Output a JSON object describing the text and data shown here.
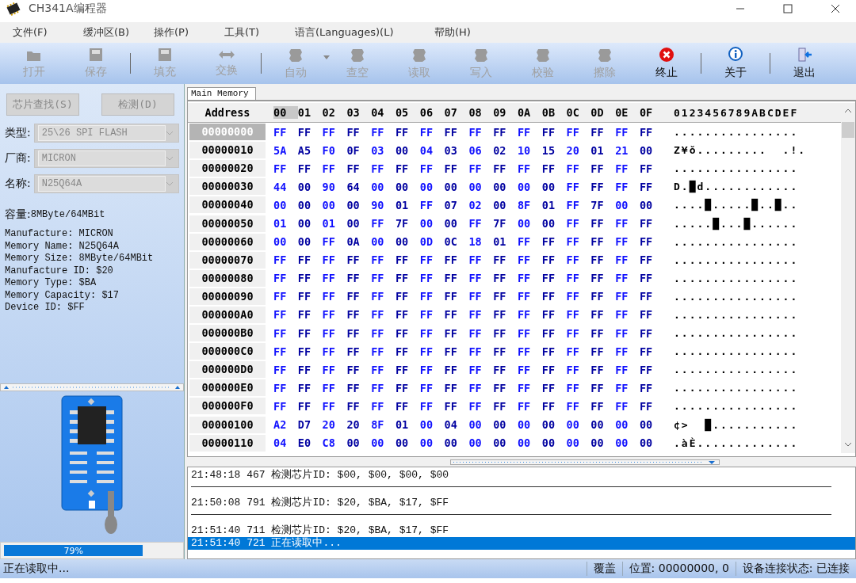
{
  "window": {
    "title": "CH341A编程器"
  },
  "menu": [
    "文件(F)",
    "缓冲区(B)",
    "操作(P)",
    "工具(T)",
    "语言(Languages)(L)",
    "帮助(H)"
  ],
  "toolbar": [
    {
      "label": "打开",
      "disabled": true,
      "separator_after": false,
      "dropdown": false
    },
    {
      "label": "保存",
      "disabled": true,
      "separator_after": true,
      "dropdown": false
    },
    {
      "label": "填充",
      "disabled": true,
      "separator_after": false,
      "dropdown": false
    },
    {
      "label": "交换",
      "disabled": true,
      "separator_after": true,
      "dropdown": false
    },
    {
      "label": "自动",
      "disabled": true,
      "separator_after": false,
      "dropdown": true
    },
    {
      "label": "查空",
      "disabled": true,
      "separator_after": false,
      "dropdown": false
    },
    {
      "label": "读取",
      "disabled": true,
      "separator_after": false,
      "dropdown": false
    },
    {
      "label": "写入",
      "disabled": true,
      "separator_after": false,
      "dropdown": false
    },
    {
      "label": "校验",
      "disabled": true,
      "separator_after": false,
      "dropdown": false
    },
    {
      "label": "擦除",
      "disabled": true,
      "separator_after": false,
      "dropdown": false
    },
    {
      "label": "终止",
      "disabled": false,
      "separator_after": true,
      "dropdown": false
    },
    {
      "label": "关于",
      "disabled": false,
      "separator_after": true,
      "dropdown": false
    },
    {
      "label": "退出",
      "disabled": false,
      "separator_after": false,
      "dropdown": false
    }
  ],
  "chip_panel": {
    "buttons": [
      "芯片查找(S)",
      "检测(D)"
    ],
    "fields": [
      {
        "label": "类型:",
        "value": "25\\26 SPI FLASH",
        "disabled": true
      },
      {
        "label": "厂商:",
        "value": "MICRON",
        "disabled": true
      },
      {
        "label": "名称:",
        "value": "N25Q64A",
        "disabled": true
      }
    ],
    "capacity": {
      "label": "容量:",
      "value": "8MByte/64MBit"
    },
    "info": [
      "Manufacture: MICRON",
      "Memory Name: N25Q64A",
      "Memory Size: 8MByte/64MBit",
      "Manufacture ID: $20",
      "Memory Type: $BA",
      "Memory Capacity: $17",
      "Device ID: $FF"
    ],
    "progress": {
      "level": 0.79,
      "label": "79%"
    }
  },
  "hex_view": {
    "tab": "Main Memory",
    "address_header": "Address",
    "columns": [
      "00",
      "01",
      "02",
      "03",
      "04",
      "05",
      "06",
      "07",
      "08",
      "09",
      "0A",
      "0B",
      "0C",
      "0D",
      "0E",
      "0F"
    ],
    "ascii_header": "0123456789ABCDEF",
    "rows": [
      {
        "address": "00000000",
        "selected": true,
        "bytes": [
          "FF",
          "FF",
          "FF",
          "FF",
          "FF",
          "FF",
          "FF",
          "FF",
          "FF",
          "FF",
          "FF",
          "FF",
          "FF",
          "FF",
          "FF",
          "FF"
        ],
        "ascii": "................"
      },
      {
        "address": "00000010",
        "selected": false,
        "bytes": [
          "5A",
          "A5",
          "F0",
          "0F",
          "03",
          "00",
          "04",
          "03",
          "06",
          "02",
          "10",
          "15",
          "20",
          "01",
          "21",
          "00"
        ],
        "ascii": "Z¥ŏ.........  .!."
      },
      {
        "address": "00000020",
        "selected": false,
        "bytes": [
          "FF",
          "FF",
          "FF",
          "FF",
          "FF",
          "FF",
          "FF",
          "FF",
          "FF",
          "FF",
          "FF",
          "FF",
          "FF",
          "FF",
          "FF",
          "FF"
        ],
        "ascii": "................"
      },
      {
        "address": "00000030",
        "selected": false,
        "bytes": [
          "44",
          "00",
          "90",
          "64",
          "00",
          "00",
          "00",
          "00",
          "00",
          "00",
          "00",
          "00",
          "FF",
          "FF",
          "FF",
          "FF"
        ],
        "ascii": "D.█d............"
      },
      {
        "address": "00000040",
        "selected": false,
        "bytes": [
          "00",
          "00",
          "00",
          "00",
          "90",
          "01",
          "FF",
          "07",
          "02",
          "00",
          "8F",
          "01",
          "FF",
          "7F",
          "00",
          "00"
        ],
        "ascii": "....█.....█..█.."
      },
      {
        "address": "00000050",
        "selected": false,
        "bytes": [
          "01",
          "00",
          "01",
          "00",
          "FF",
          "7F",
          "00",
          "00",
          "FF",
          "7F",
          "00",
          "00",
          "FF",
          "FF",
          "FF",
          "FF"
        ],
        "ascii": ".....█...█......"
      },
      {
        "address": "00000060",
        "selected": false,
        "bytes": [
          "00",
          "00",
          "FF",
          "0A",
          "00",
          "00",
          "0D",
          "0C",
          "18",
          "01",
          "FF",
          "FF",
          "FF",
          "FF",
          "FF",
          "FF"
        ],
        "ascii": "................"
      },
      {
        "address": "00000070",
        "selected": false,
        "bytes": [
          "FF",
          "FF",
          "FF",
          "FF",
          "FF",
          "FF",
          "FF",
          "FF",
          "FF",
          "FF",
          "FF",
          "FF",
          "FF",
          "FF",
          "FF",
          "FF"
        ],
        "ascii": "................"
      },
      {
        "address": "00000080",
        "selected": false,
        "bytes": [
          "FF",
          "FF",
          "FF",
          "FF",
          "FF",
          "FF",
          "FF",
          "FF",
          "FF",
          "FF",
          "FF",
          "FF",
          "FF",
          "FF",
          "FF",
          "FF"
        ],
        "ascii": "................"
      },
      {
        "address": "00000090",
        "selected": false,
        "bytes": [
          "FF",
          "FF",
          "FF",
          "FF",
          "FF",
          "FF",
          "FF",
          "FF",
          "FF",
          "FF",
          "FF",
          "FF",
          "FF",
          "FF",
          "FF",
          "FF"
        ],
        "ascii": "................"
      },
      {
        "address": "000000A0",
        "selected": false,
        "bytes": [
          "FF",
          "FF",
          "FF",
          "FF",
          "FF",
          "FF",
          "FF",
          "FF",
          "FF",
          "FF",
          "FF",
          "FF",
          "FF",
          "FF",
          "FF",
          "FF"
        ],
        "ascii": "................"
      },
      {
        "address": "000000B0",
        "selected": false,
        "bytes": [
          "FF",
          "FF",
          "FF",
          "FF",
          "FF",
          "FF",
          "FF",
          "FF",
          "FF",
          "FF",
          "FF",
          "FF",
          "FF",
          "FF",
          "FF",
          "FF"
        ],
        "ascii": "................"
      },
      {
        "address": "000000C0",
        "selected": false,
        "bytes": [
          "FF",
          "FF",
          "FF",
          "FF",
          "FF",
          "FF",
          "FF",
          "FF",
          "FF",
          "FF",
          "FF",
          "FF",
          "FF",
          "FF",
          "FF",
          "FF"
        ],
        "ascii": "................"
      },
      {
        "address": "000000D0",
        "selected": false,
        "bytes": [
          "FF",
          "FF",
          "FF",
          "FF",
          "FF",
          "FF",
          "FF",
          "FF",
          "FF",
          "FF",
          "FF",
          "FF",
          "FF",
          "FF",
          "FF",
          "FF"
        ],
        "ascii": "................"
      },
      {
        "address": "000000E0",
        "selected": false,
        "bytes": [
          "FF",
          "FF",
          "FF",
          "FF",
          "FF",
          "FF",
          "FF",
          "FF",
          "FF",
          "FF",
          "FF",
          "FF",
          "FF",
          "FF",
          "FF",
          "FF"
        ],
        "ascii": "................"
      },
      {
        "address": "000000F0",
        "selected": false,
        "bytes": [
          "FF",
          "FF",
          "FF",
          "FF",
          "FF",
          "FF",
          "FF",
          "FF",
          "FF",
          "FF",
          "FF",
          "FF",
          "FF",
          "FF",
          "FF",
          "FF"
        ],
        "ascii": "................"
      },
      {
        "address": "00000100",
        "selected": false,
        "bytes": [
          "A2",
          "D7",
          "20",
          "20",
          "8F",
          "01",
          "00",
          "04",
          "00",
          "00",
          "00",
          "00",
          "00",
          "00",
          "00",
          "00"
        ],
        "ascii": "¢>  █..........."
      },
      {
        "address": "00000110",
        "selected": false,
        "bytes": [
          "04",
          "E0",
          "C8",
          "00",
          "00",
          "00",
          "00",
          "00",
          "00",
          "00",
          "00",
          "00",
          "00",
          "00",
          "00",
          "00"
        ],
        "ascii": ".àÈ............."
      }
    ]
  },
  "log": [
    {
      "time": "21:48:18 467",
      "text": "检测芯片ID: $00, $00, $00, $00",
      "selected": false
    },
    {
      "time": "21:50:08 791",
      "text": "检测芯片ID: $20, $BA, $17, $FF",
      "selected": false
    },
    {
      "time": "21:51:40 711",
      "text": "检测芯片ID: $20, $BA, $17, $FF",
      "selected": false
    },
    {
      "time": "21:51:40 721",
      "text": "正在读取中...",
      "selected": true
    }
  ],
  "status_bar": {
    "message": "正在读取中...",
    "mode": "覆盖",
    "position": "位置: 00000000, 0",
    "connection": "设备连接状态: 已连接"
  }
}
